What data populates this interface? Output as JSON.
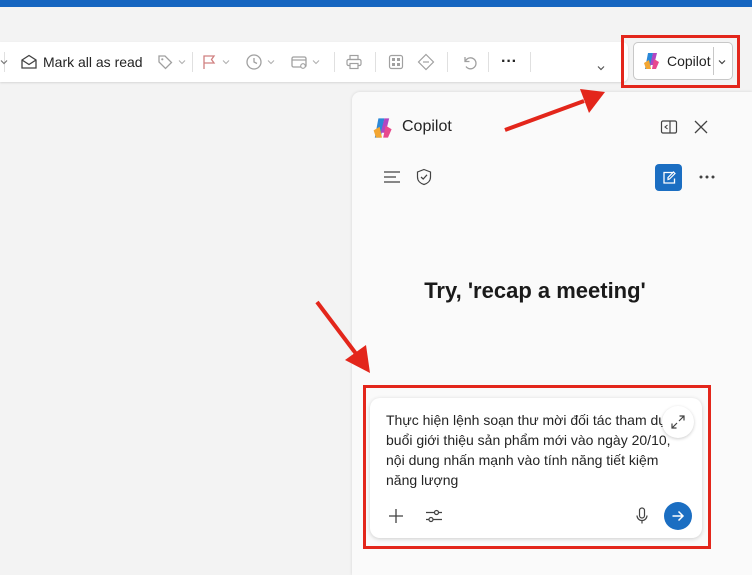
{
  "toolbar": {
    "mark_all_read_label": "Mark all as read",
    "more_label": "···"
  },
  "copilot_button": {
    "label": "Copilot"
  },
  "copilot_panel": {
    "title": "Copilot",
    "prompt_heading": "Try, 'recap a meeting'",
    "input_text": "Thực hiện lệnh soạn thư mời đối tác tham dự buổi giới thiệu sản phẩm mới vào ngày 20/10, nội dung nhấn mạnh vào tính năng tiết kiệm năng lượng"
  },
  "colors": {
    "accent": "#1b6ec2",
    "annotation_red": "#e3261b",
    "top_bar": "#1565c0"
  }
}
